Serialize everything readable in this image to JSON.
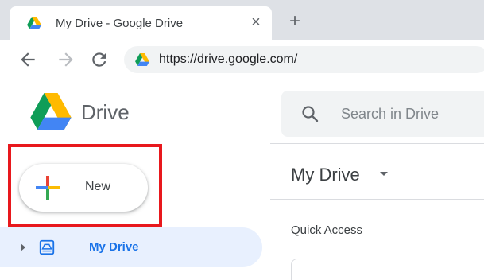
{
  "browser": {
    "tab": {
      "title": "My Drive - Google Drive",
      "close_icon": "close-icon",
      "favicon": "google-drive-icon"
    },
    "new_tab_icon": "plus-icon",
    "nav": {
      "back_icon": "arrow-back-icon",
      "forward_icon": "arrow-forward-icon",
      "reload_icon": "reload-icon"
    },
    "address": {
      "url": "https://drive.google.com/"
    }
  },
  "app": {
    "logo_icon": "google-drive-icon",
    "name": "Drive",
    "search": {
      "placeholder": "Search in Drive",
      "icon": "search-icon"
    }
  },
  "sidebar": {
    "new_button": {
      "label": "New",
      "icon": "multicolor-plus-icon",
      "highlight_color": "#e8181d"
    },
    "items": [
      {
        "label": "My Drive",
        "icon": "my-drive-icon",
        "active": true
      }
    ]
  },
  "main": {
    "location": "My Drive",
    "section": "Quick Access"
  },
  "colors": {
    "accent": "#1a73e8",
    "active_bg": "#e8f0fe",
    "highlight": "#e8181d"
  }
}
